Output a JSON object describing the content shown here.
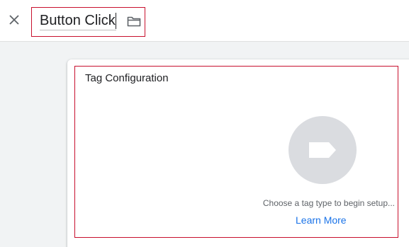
{
  "header": {
    "close_icon": "close-icon",
    "tag_name_value": "Button Click",
    "folder_icon": "folder-icon"
  },
  "tag_configuration": {
    "title": "Tag Configuration",
    "tag_type_icon": "tag-icon",
    "hint": "Choose a tag type to begin setup...",
    "learn_more_label": "Learn More"
  },
  "colors": {
    "highlight_border": "#c8102e",
    "link": "#1a73e8",
    "icon_placeholder_bg": "#dadce0",
    "canvas_bg": "#f1f3f4"
  }
}
